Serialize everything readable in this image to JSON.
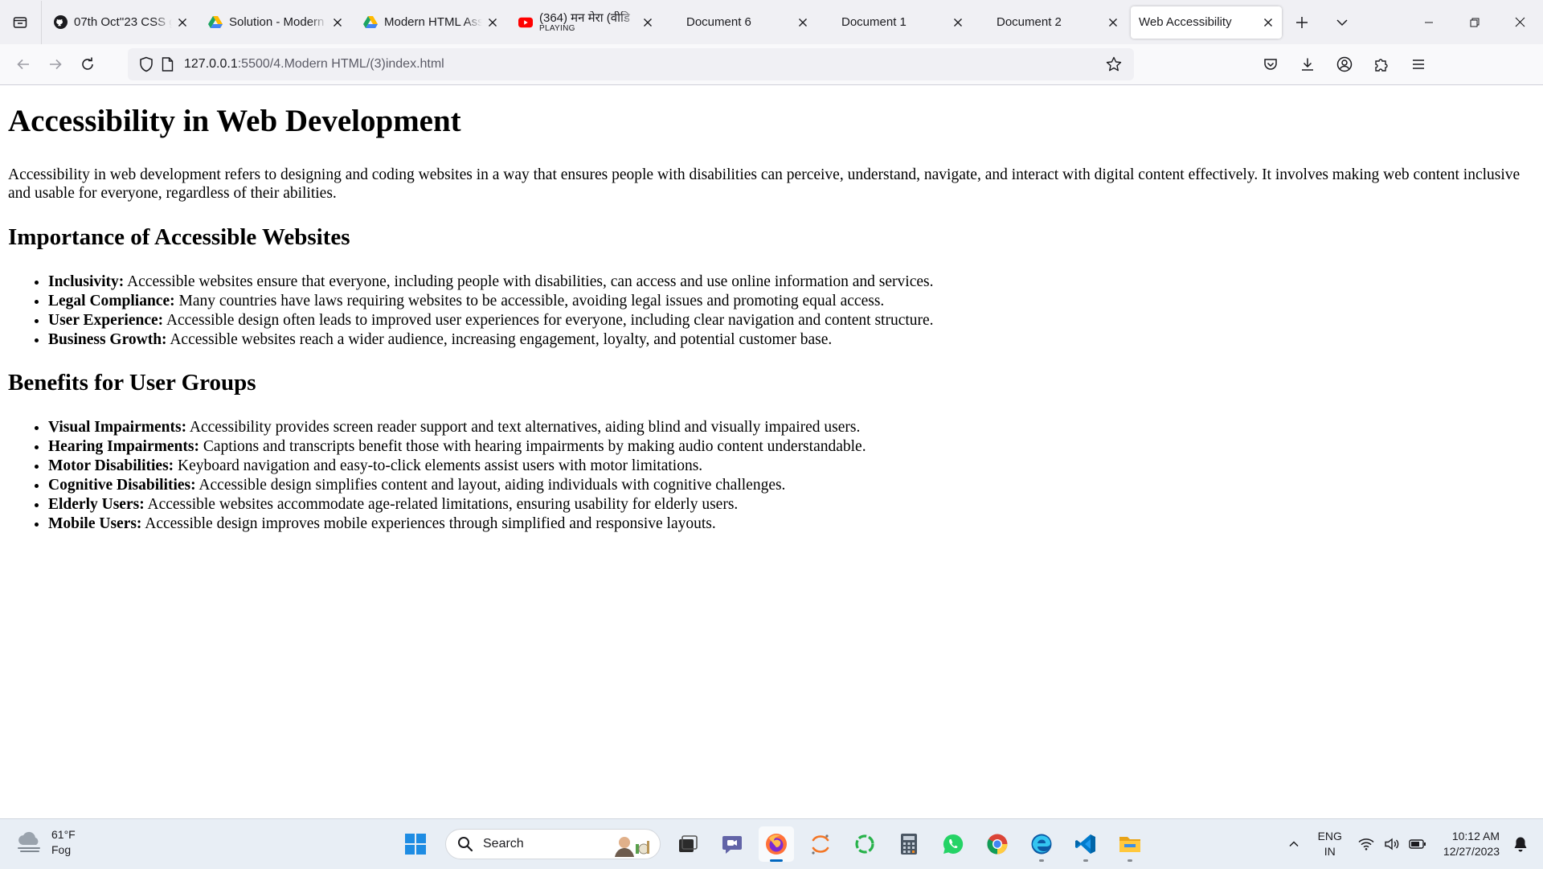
{
  "browser": {
    "tabs": [
      {
        "title": "07th Oct''23 CSS g",
        "icon": "github-icon"
      },
      {
        "title": "Solution - Modern",
        "icon": "google-drive-icon"
      },
      {
        "title": "Modern HTML Ass",
        "icon": "google-drive-icon"
      },
      {
        "title": "(364) मन मेरा (वीडि",
        "subtitle": "PLAYING",
        "icon": "youtube-icon"
      },
      {
        "title": "Document 6"
      },
      {
        "title": "Document 1"
      },
      {
        "title": "Document 2"
      },
      {
        "title": "Web Accessibility",
        "selected": true
      }
    ],
    "url": {
      "host": "127.0.0.1",
      "path": ":5500/4.Modern HTML/(3)index.html"
    }
  },
  "page": {
    "title": "Accessibility in Web Development",
    "intro": "Accessibility in web development refers to designing and coding websites in a way that ensures people with disabilities can perceive, understand, navigate, and interact with digital content effectively. It involves making web content inclusive and usable for everyone, regardless of their abilities.",
    "importance": {
      "heading": "Importance of Accessible Websites",
      "items": [
        {
          "term": "Inclusivity:",
          "text": " Accessible websites ensure that everyone, including people with disabilities, can access and use online information and services."
        },
        {
          "term": "Legal Compliance:",
          "text": " Many countries have laws requiring websites to be accessible, avoiding legal issues and promoting equal access."
        },
        {
          "term": "User Experience:",
          "text": " Accessible design often leads to improved user experiences for everyone, including clear navigation and content structure."
        },
        {
          "term": "Business Growth:",
          "text": " Accessible websites reach a wider audience, increasing engagement, loyalty, and potential customer base."
        }
      ]
    },
    "benefits": {
      "heading": "Benefits for User Groups",
      "items": [
        {
          "term": "Visual Impairments:",
          "text": " Accessibility provides screen reader support and text alternatives, aiding blind and visually impaired users."
        },
        {
          "term": "Hearing Impairments:",
          "text": " Captions and transcripts benefit those with hearing impairments by making audio content understandable."
        },
        {
          "term": "Motor Disabilities:",
          "text": " Keyboard navigation and easy-to-click elements assist users with motor limitations."
        },
        {
          "term": "Cognitive Disabilities:",
          "text": " Accessible design simplifies content and layout, aiding individuals with cognitive challenges."
        },
        {
          "term": "Elderly Users:",
          "text": " Accessible websites accommodate age-related limitations, ensuring usability for elderly users."
        },
        {
          "term": "Mobile Users:",
          "text": " Accessible design improves mobile experiences through simplified and responsive layouts."
        }
      ]
    }
  },
  "taskbar": {
    "weather": {
      "temp": "61°F",
      "condition": "Fog"
    },
    "search_label": "Search",
    "apps": [
      "windows-start-icon",
      "task-view-icon",
      "teams-chat-icon",
      "firefox-icon",
      "jupyter-icon",
      "refresh-app-icon",
      "calculator-icon",
      "whatsapp-icon",
      "chrome-icon",
      "edge-icon",
      "vscode-icon",
      "file-explorer-icon"
    ],
    "active_app": "firefox-icon",
    "lang": {
      "line1": "ENG",
      "line2": "IN"
    },
    "clock": {
      "time": "10:12 AM",
      "date": "12/27/2023"
    }
  },
  "colors": {
    "tab_strip": "#f0f0f4",
    "toolbar": "#f9f9fb",
    "taskbar": "#e8eef5",
    "accent": "#0067c0"
  }
}
